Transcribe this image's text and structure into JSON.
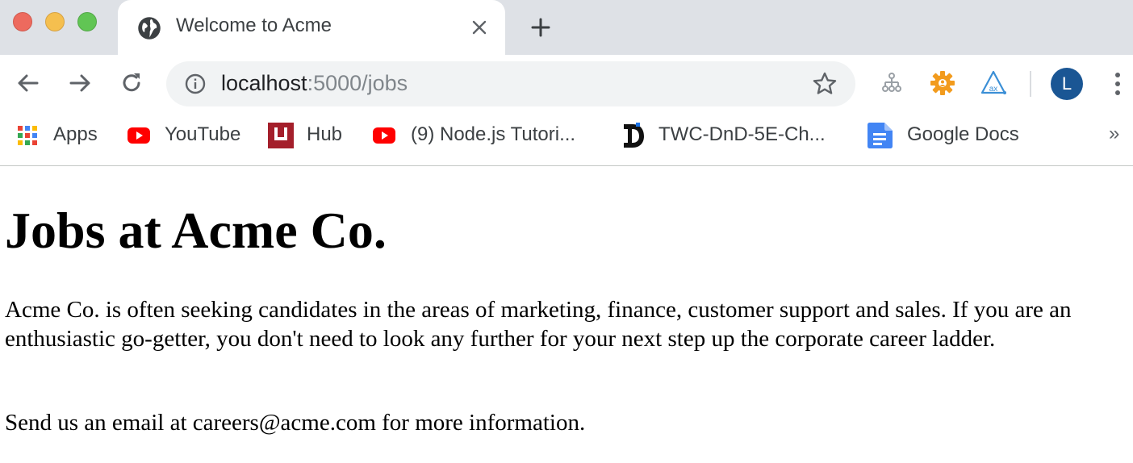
{
  "window": {
    "tab_title": "Welcome to Acme",
    "new_tab_label": "+"
  },
  "toolbar": {
    "url_host": "localhost",
    "url_path": ":5000/jobs",
    "avatar_letter": "L"
  },
  "bookmarks": {
    "items": [
      {
        "label": "Apps",
        "icon": "apps-grid-icon"
      },
      {
        "label": "YouTube",
        "icon": "youtube-icon"
      },
      {
        "label": "Hub",
        "icon": "hub-icon"
      },
      {
        "label": "(9) Node.js Tutori...",
        "icon": "youtube-icon"
      },
      {
        "label": "TWC-DnD-5E-Ch...",
        "icon": "dndbeyond-icon"
      },
      {
        "label": "Google Docs",
        "icon": "google-docs-icon"
      }
    ],
    "overflow": "»"
  },
  "page": {
    "heading": "Jobs at Acme Co.",
    "paragraph": "Acme Co. is often seeking candidates in the areas of marketing, finance, customer support and sales. If you are an enthusiastic go-getter, you don't need to look any further for your next step up the corporate career ladder.",
    "contact": "Send us an email at careers@acme.com for more information."
  },
  "colors": {
    "tabstrip_bg": "#dee1e6",
    "omnibox_bg": "#f1f3f4",
    "avatar_bg": "#1a5694",
    "youtube_red": "#ff0000",
    "docs_blue": "#4285f4"
  }
}
